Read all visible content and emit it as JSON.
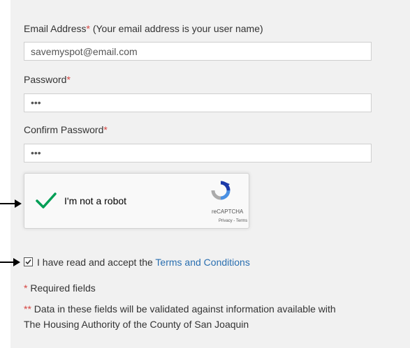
{
  "form": {
    "email_label": "Email Address",
    "email_star": "*",
    "email_hint": " (Your email address is your user name)",
    "email_value": "savemyspot@email.com",
    "password_label": "Password",
    "password_star": "*",
    "password_mask": "•••",
    "confirm_label": "Confirm Password",
    "confirm_star": "*",
    "confirm_mask": "•••"
  },
  "captcha": {
    "checkbox_text": "I'm not a robot",
    "brand": "reCAPTCHA",
    "privacy_terms": "Privacy - Terms",
    "checked": true
  },
  "terms": {
    "prefix": "I have read and accept the ",
    "link_text": "Terms and Conditions",
    "checked": true
  },
  "notes": {
    "required_marker": "*",
    "required_text": " Required fields",
    "validated_marker": "**",
    "validated_line1": " Data in these fields will be validated against information available with",
    "validated_line2": "The Housing Authority of the County of San Joaquin"
  },
  "colors": {
    "panel_bg": "#f1f1f1",
    "required": "#d64541",
    "link": "#2a6fb0",
    "captcha_check": "#009e55"
  },
  "icons": {
    "arrows": "right-arrow-icon",
    "captcha_logo": "recaptcha-logo-icon",
    "captcha_check": "green-checkmark-icon"
  }
}
